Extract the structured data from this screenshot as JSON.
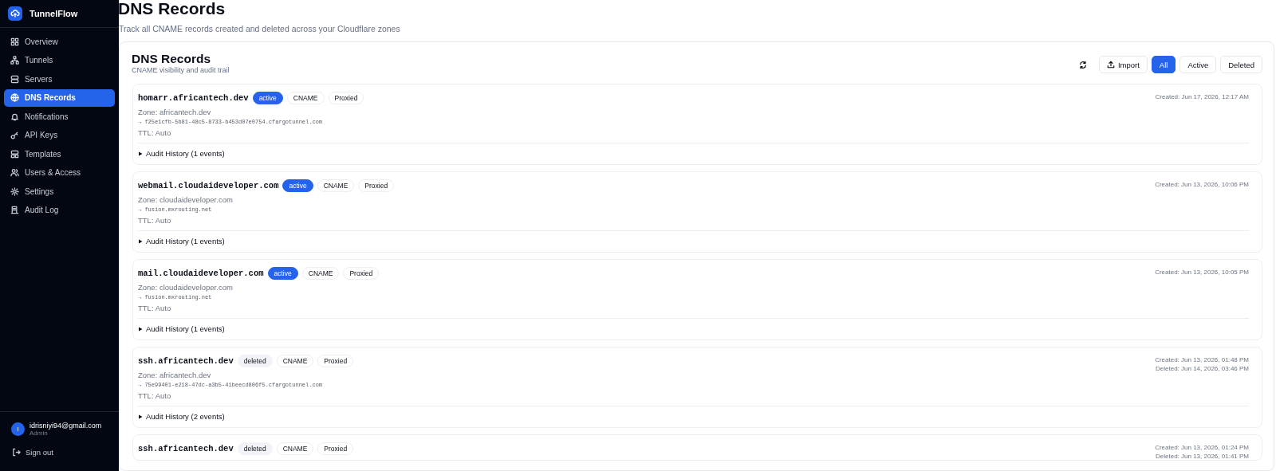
{
  "sidebar": {
    "brand": "TunnelFlow",
    "items": [
      {
        "label": "Overview",
        "selected": false
      },
      {
        "label": "Tunnels",
        "selected": false
      },
      {
        "label": "Servers",
        "selected": false
      },
      {
        "label": "DNS Records",
        "selected": true
      },
      {
        "label": "Notifications",
        "selected": false
      },
      {
        "label": "API Keys",
        "selected": false
      },
      {
        "label": "Templates",
        "selected": false
      },
      {
        "label": "Users & Access",
        "selected": false
      },
      {
        "label": "Settings",
        "selected": false
      },
      {
        "label": "Audit Log",
        "selected": false
      }
    ],
    "user": {
      "initial": "I",
      "email": "idrisniyi94@gmail.com",
      "role": "Admin"
    },
    "sign_out": "Sign out"
  },
  "page": {
    "title": "DNS Records",
    "subtitle": "Track all CNAME records created and deleted across your Cloudflare zones"
  },
  "panel": {
    "title": "DNS Records",
    "subtitle": "CNAME visibility and audit trail",
    "import_label": "Import",
    "filters": [
      {
        "label": "All",
        "selected": true
      },
      {
        "label": "Active",
        "selected": false
      },
      {
        "label": "Deleted",
        "selected": false
      }
    ]
  },
  "records": [
    {
      "name": "homarr.africantech.dev",
      "status": "active",
      "type": "CNAME",
      "proxy": "Proxied",
      "zone": "Zone: africantech.dev",
      "target": "→ f25e1cfb-5b81-48c5-8733-b453d07e0754.cfargotunnel.com",
      "ttl": "TTL: Auto",
      "audit": "Audit History (1 events)",
      "created": "Created: Jun 17, 2026, 12:17 AM"
    },
    {
      "name": "webmail.cloudaideveloper.com",
      "status": "active",
      "type": "CNAME",
      "proxy": "Proxied",
      "zone": "Zone: cloudaideveloper.com",
      "target": "→ fusion.mxrouting.net",
      "ttl": "TTL: Auto",
      "audit": "Audit History (1 events)",
      "created": "Created: Jun 13, 2026, 10:06 PM"
    },
    {
      "name": "mail.cloudaideveloper.com",
      "status": "active",
      "type": "CNAME",
      "proxy": "Proxied",
      "zone": "Zone: cloudaideveloper.com",
      "target": "→ fusion.mxrouting.net",
      "ttl": "TTL: Auto",
      "audit": "Audit History (1 events)",
      "created": "Created: Jun 13, 2026, 10:05 PM"
    },
    {
      "name": "ssh.africantech.dev",
      "status": "deleted",
      "type": "CNAME",
      "proxy": "Proxied",
      "zone": "Zone: africantech.dev",
      "target": "→ 75e99401-e218-47dc-a3b5-41beecd806f5.cfargotunnel.com",
      "ttl": "TTL: Auto",
      "audit": "Audit History (2 events)",
      "created": "Created: Jun 13, 2026, 01:48 PM",
      "deleted": "Deleted: Jun 14, 2026, 03:46 PM"
    },
    {
      "name": "ssh.africantech.dev",
      "status": "deleted",
      "type": "CNAME",
      "proxy": "Proxied",
      "created": "Created: Jun 13, 2026, 01:24 PM",
      "deleted": "Deleted: Jun 13, 2026, 01:41 PM"
    }
  ]
}
